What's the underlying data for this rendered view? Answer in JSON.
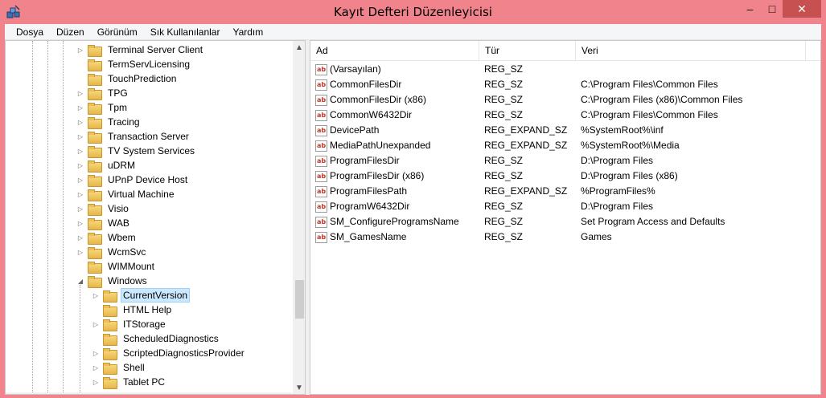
{
  "window": {
    "title": "Kayıt Defteri Düzenleyicisi"
  },
  "titlebar": {
    "minimize": "–",
    "maximize": "□",
    "close": "✕"
  },
  "menu": [
    "Dosya",
    "Düzen",
    "Görünüm",
    "Sık Kullanılanlar",
    "Yardım"
  ],
  "tree": {
    "items": [
      {
        "label": "Terminal Server Client",
        "level": 0,
        "expander": "collapsed"
      },
      {
        "label": "TermServLicensing",
        "level": 0,
        "expander": "none"
      },
      {
        "label": "TouchPrediction",
        "level": 0,
        "expander": "none"
      },
      {
        "label": "TPG",
        "level": 0,
        "expander": "collapsed"
      },
      {
        "label": "Tpm",
        "level": 0,
        "expander": "collapsed"
      },
      {
        "label": "Tracing",
        "level": 0,
        "expander": "collapsed"
      },
      {
        "label": "Transaction Server",
        "level": 0,
        "expander": "collapsed"
      },
      {
        "label": "TV System Services",
        "level": 0,
        "expander": "collapsed"
      },
      {
        "label": "uDRM",
        "level": 0,
        "expander": "collapsed"
      },
      {
        "label": "UPnP Device Host",
        "level": 0,
        "expander": "collapsed"
      },
      {
        "label": "Virtual Machine",
        "level": 0,
        "expander": "collapsed"
      },
      {
        "label": "Visio",
        "level": 0,
        "expander": "collapsed"
      },
      {
        "label": "WAB",
        "level": 0,
        "expander": "collapsed"
      },
      {
        "label": "Wbem",
        "level": 0,
        "expander": "collapsed"
      },
      {
        "label": "WcmSvc",
        "level": 0,
        "expander": "collapsed"
      },
      {
        "label": "WIMMount",
        "level": 0,
        "expander": "none"
      },
      {
        "label": "Windows",
        "level": 0,
        "expander": "expanded"
      },
      {
        "label": "CurrentVersion",
        "level": 1,
        "expander": "collapsed",
        "selected": true
      },
      {
        "label": "HTML Help",
        "level": 1,
        "expander": "none"
      },
      {
        "label": "ITStorage",
        "level": 1,
        "expander": "collapsed"
      },
      {
        "label": "ScheduledDiagnostics",
        "level": 1,
        "expander": "none"
      },
      {
        "label": "ScriptedDiagnosticsProvider",
        "level": 1,
        "expander": "collapsed"
      },
      {
        "label": "Shell",
        "level": 1,
        "expander": "collapsed"
      },
      {
        "label": "Tablet PC",
        "level": 1,
        "expander": "collapsed"
      }
    ]
  },
  "list": {
    "columns": {
      "name": "Ad",
      "type": "Tür",
      "data": "Veri"
    },
    "rows": [
      {
        "name": "(Varsayılan)",
        "type": "REG_SZ",
        "data": ""
      },
      {
        "name": "CommonFilesDir",
        "type": "REG_SZ",
        "data": "C:\\Program Files\\Common Files"
      },
      {
        "name": "CommonFilesDir (x86)",
        "type": "REG_SZ",
        "data": "C:\\Program Files (x86)\\Common Files"
      },
      {
        "name": "CommonW6432Dir",
        "type": "REG_SZ",
        "data": "C:\\Program Files\\Common Files"
      },
      {
        "name": "DevicePath",
        "type": "REG_EXPAND_SZ",
        "data": "%SystemRoot%\\inf"
      },
      {
        "name": "MediaPathUnexpanded",
        "type": "REG_EXPAND_SZ",
        "data": "%SystemRoot%\\Media"
      },
      {
        "name": "ProgramFilesDir",
        "type": "REG_SZ",
        "data": "D:\\Program Files"
      },
      {
        "name": "ProgramFilesDir (x86)",
        "type": "REG_SZ",
        "data": "D:\\Program Files (x86)"
      },
      {
        "name": "ProgramFilesPath",
        "type": "REG_EXPAND_SZ",
        "data": "%ProgramFiles%"
      },
      {
        "name": "ProgramW6432Dir",
        "type": "REG_SZ",
        "data": "D:\\Program Files"
      },
      {
        "name": "SM_ConfigureProgramsName",
        "type": "REG_SZ",
        "data": "Set Program Access and Defaults"
      },
      {
        "name": "SM_GamesName",
        "type": "REG_SZ",
        "data": "Games"
      }
    ]
  },
  "colors": {
    "titlebar": "#f0838c",
    "close_button": "#c75050",
    "selection": "#cce8ff"
  }
}
